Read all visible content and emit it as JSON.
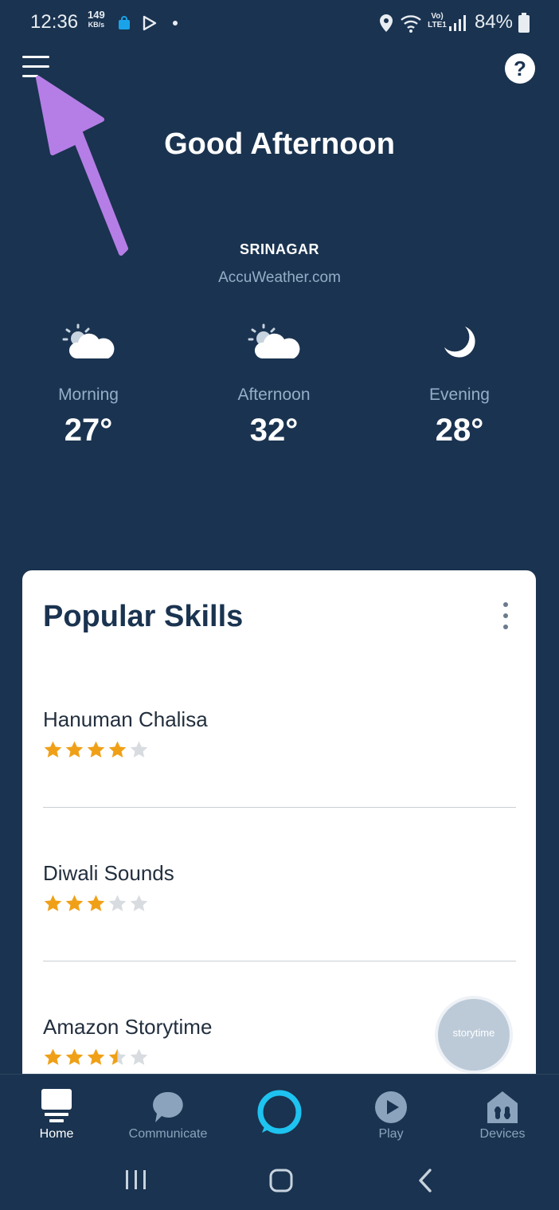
{
  "status_bar": {
    "time": "12:36",
    "net_speed_value": "149",
    "net_speed_unit": "KB/s",
    "signal_type": "Vo) LTE1",
    "battery": "84%",
    "icons": [
      "bag-icon",
      "play-store-icon",
      "dot-icon",
      "location-icon",
      "wifi-icon",
      "signal-icon",
      "battery-icon"
    ]
  },
  "header": {
    "greeting": "Good Afternoon",
    "help_label": "?"
  },
  "weather": {
    "city": "SRINAGAR",
    "provider": "AccuWeather.com",
    "forecast": [
      {
        "period": "Morning",
        "temp": "27°",
        "icon": "partly-cloudy-icon"
      },
      {
        "period": "Afternoon",
        "temp": "32°",
        "icon": "partly-cloudy-icon"
      },
      {
        "period": "Evening",
        "temp": "28°",
        "icon": "moon-icon"
      }
    ]
  },
  "popular_skills": {
    "title": "Popular Skills",
    "items": [
      {
        "name": "Hanuman Chalisa",
        "rating": 4,
        "max": 5
      },
      {
        "name": "Diwali Sounds",
        "rating": 3,
        "max": 5
      },
      {
        "name": "Amazon Storytime",
        "rating": 3.5,
        "max": 5,
        "thumb_label": "storytime"
      }
    ]
  },
  "bottom_nav": {
    "items": [
      {
        "label": "Home",
        "active": true
      },
      {
        "label": "Communicate",
        "active": false
      },
      {
        "label": "Play",
        "active": false
      },
      {
        "label": "Devices",
        "active": false
      }
    ]
  },
  "colors": {
    "background": "#1a3350",
    "card": "#ffffff",
    "star": "#f0a017",
    "star_empty": "#d8dce0",
    "alexa_ring": "#1ec3f0",
    "annotation_arrow": "#b57ee6"
  }
}
